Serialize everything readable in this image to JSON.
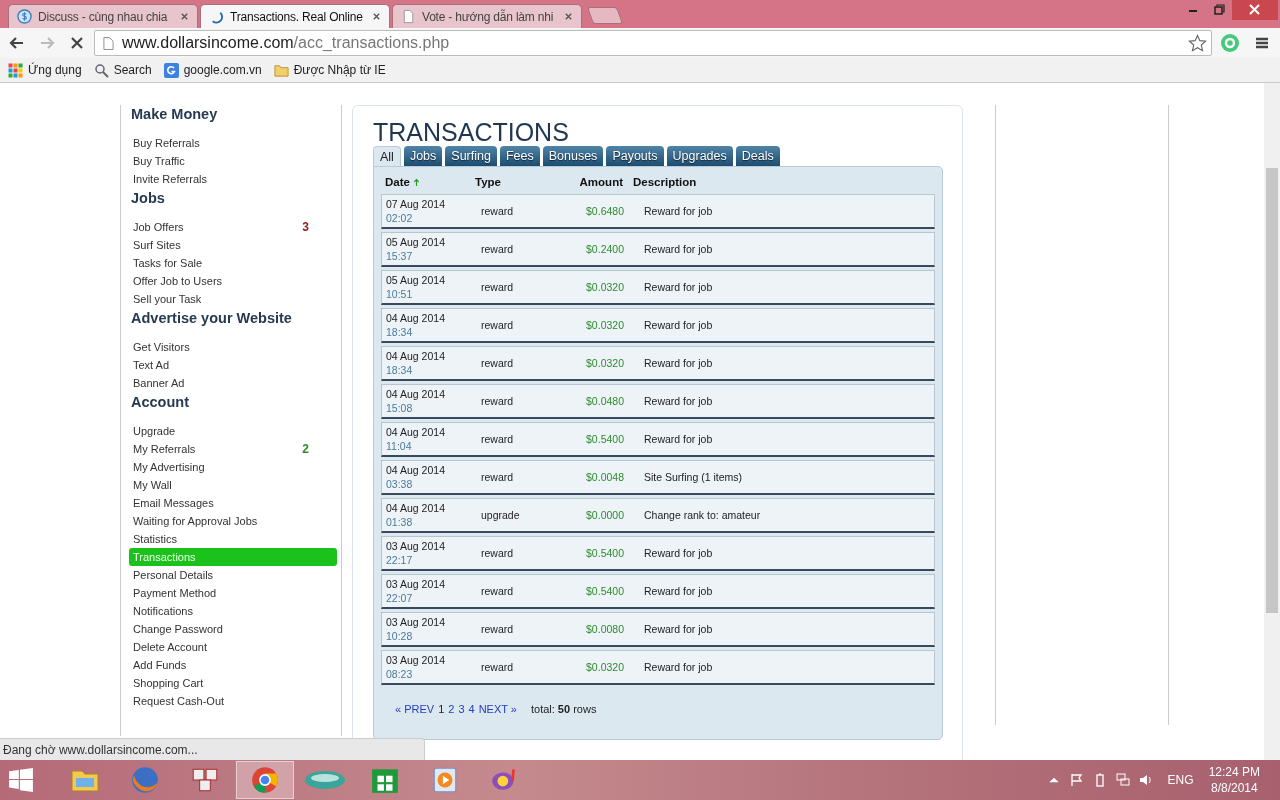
{
  "browser": {
    "tabs": [
      {
        "title": "Discuss - cùng nhau chia",
        "kind": "site",
        "selected": false
      },
      {
        "title": "Transactions. Real Online",
        "kind": "loading",
        "selected": true
      },
      {
        "title": "Vote - hướng dẫn làm nhi",
        "kind": "page",
        "selected": false
      }
    ],
    "address": {
      "host": "www.dollarsincome.com",
      "path": "/acc_transactions.php"
    },
    "bookmarks": [
      {
        "label": "Ứng dụng",
        "kind": "apps"
      },
      {
        "label": "Search",
        "kind": "search"
      },
      {
        "label": "google.com.vn",
        "kind": "google"
      },
      {
        "label": "Được Nhập từ IE",
        "kind": "folder"
      }
    ]
  },
  "sidebar": [
    {
      "heading": "Make Money",
      "items": [
        {
          "label": "Buy Referrals",
          "selected": false
        },
        {
          "label": "Buy Traffic",
          "selected": false
        },
        {
          "label": "Invite Referrals",
          "selected": false
        }
      ]
    },
    {
      "heading": "Jobs",
      "items": [
        {
          "label": "Job Offers",
          "selected": false,
          "count": "3",
          "color": "#8b2020"
        },
        {
          "label": "Surf Sites",
          "selected": false
        },
        {
          "label": "Tasks for Sale",
          "selected": false
        },
        {
          "label": "Offer Job to Users",
          "selected": false
        },
        {
          "label": "Sell your Task",
          "selected": false
        }
      ]
    },
    {
      "heading": "Advertise your Website",
      "items": [
        {
          "label": "Get Visitors",
          "selected": false
        },
        {
          "label": "Text Ad",
          "selected": false
        },
        {
          "label": "Banner Ad",
          "selected": false
        }
      ]
    },
    {
      "heading": "Account",
      "items": [
        {
          "label": "Upgrade",
          "selected": false
        },
        {
          "label": "My Referrals",
          "selected": false,
          "count": "2",
          "color": "#2e8b2e"
        },
        {
          "label": "My Advertising",
          "selected": false
        },
        {
          "label": "My Wall",
          "selected": false
        },
        {
          "label": "Email Messages",
          "selected": false
        },
        {
          "label": "Waiting for Approval Jobs",
          "selected": false
        },
        {
          "label": "Statistics",
          "selected": false
        },
        {
          "label": "Transactions",
          "selected": true
        },
        {
          "label": "Personal Details",
          "selected": false
        },
        {
          "label": "Payment Method",
          "selected": false
        },
        {
          "label": "Notifications",
          "selected": false
        },
        {
          "label": "Change Password",
          "selected": false
        },
        {
          "label": "Delete Account",
          "selected": false
        },
        {
          "label": "Add Funds",
          "selected": false
        },
        {
          "label": "Shopping Cart",
          "selected": false
        },
        {
          "label": "Request Cash-Out",
          "selected": false
        }
      ]
    }
  ],
  "page_title": "TRANSACTIONS",
  "filter_tabs": [
    {
      "label": "All",
      "selected": true
    },
    {
      "label": "Jobs",
      "selected": false
    },
    {
      "label": "Surfing",
      "selected": false
    },
    {
      "label": "Fees",
      "selected": false
    },
    {
      "label": "Bonuses",
      "selected": false
    },
    {
      "label": "Payouts",
      "selected": false
    },
    {
      "label": "Upgrades",
      "selected": false
    },
    {
      "label": "Deals",
      "selected": false
    }
  ],
  "table": {
    "columns": [
      {
        "label": "Date",
        "sorted": true
      },
      {
        "label": "Type",
        "sorted": false
      },
      {
        "label": "Amount",
        "sorted": false
      },
      {
        "label": "Description",
        "sorted": false
      }
    ],
    "rows": [
      {
        "date": "07 Aug 2014",
        "time": "02:02",
        "type": "reward",
        "amount": "$0.6480",
        "description": "Reward for job"
      },
      {
        "date": "05 Aug 2014",
        "time": "15:37",
        "type": "reward",
        "amount": "$0.2400",
        "description": "Reward for job"
      },
      {
        "date": "05 Aug 2014",
        "time": "10:51",
        "type": "reward",
        "amount": "$0.0320",
        "description": "Reward for job"
      },
      {
        "date": "04 Aug 2014",
        "time": "18:34",
        "type": "reward",
        "amount": "$0.0320",
        "description": "Reward for job"
      },
      {
        "date": "04 Aug 2014",
        "time": "18:34",
        "type": "reward",
        "amount": "$0.0320",
        "description": "Reward for job"
      },
      {
        "date": "04 Aug 2014",
        "time": "15:08",
        "type": "reward",
        "amount": "$0.0480",
        "description": "Reward for job"
      },
      {
        "date": "04 Aug 2014",
        "time": "11:04",
        "type": "reward",
        "amount": "$0.5400",
        "description": "Reward for job"
      },
      {
        "date": "04 Aug 2014",
        "time": "03:38",
        "type": "reward",
        "amount": "$0.0048",
        "description": "Site Surfing (1 items)"
      },
      {
        "date": "04 Aug 2014",
        "time": "01:38",
        "type": "upgrade",
        "amount": "$0.0000",
        "description": "Change rank to: amateur"
      },
      {
        "date": "03 Aug 2014",
        "time": "22:17",
        "type": "reward",
        "amount": "$0.5400",
        "description": "Reward for job"
      },
      {
        "date": "03 Aug 2014",
        "time": "22:07",
        "type": "reward",
        "amount": "$0.5400",
        "description": "Reward for job"
      },
      {
        "date": "03 Aug 2014",
        "time": "10:28",
        "type": "reward",
        "amount": "$0.0080",
        "description": "Reward for job"
      },
      {
        "date": "03 Aug 2014",
        "time": "08:23",
        "type": "reward",
        "amount": "$0.0320",
        "description": "Reward for job"
      }
    ]
  },
  "pagination": {
    "prev": "« PREV",
    "pages": [
      {
        "label": "1",
        "selected": true
      },
      {
        "label": "2",
        "selected": false
      },
      {
        "label": "3",
        "selected": false
      },
      {
        "label": "4",
        "selected": false
      }
    ],
    "next": "NEXT »",
    "total": "total: **50** rows"
  },
  "status_bubble": "Đang chờ www.dollarsincome.com...",
  "taskbar": {
    "apps": [
      {
        "kind": "explorer",
        "selected": false
      },
      {
        "kind": "firefox",
        "selected": false
      },
      {
        "kind": "uni",
        "selected": false
      },
      {
        "kind": "chrome",
        "selected": true
      },
      {
        "kind": "viettel",
        "selected": false
      },
      {
        "kind": "store",
        "selected": false
      },
      {
        "kind": "media",
        "selected": false
      },
      {
        "kind": "messenger",
        "selected": false
      }
    ],
    "language": "ENG",
    "time": "12:24 PM",
    "date": "8/8/2014"
  }
}
